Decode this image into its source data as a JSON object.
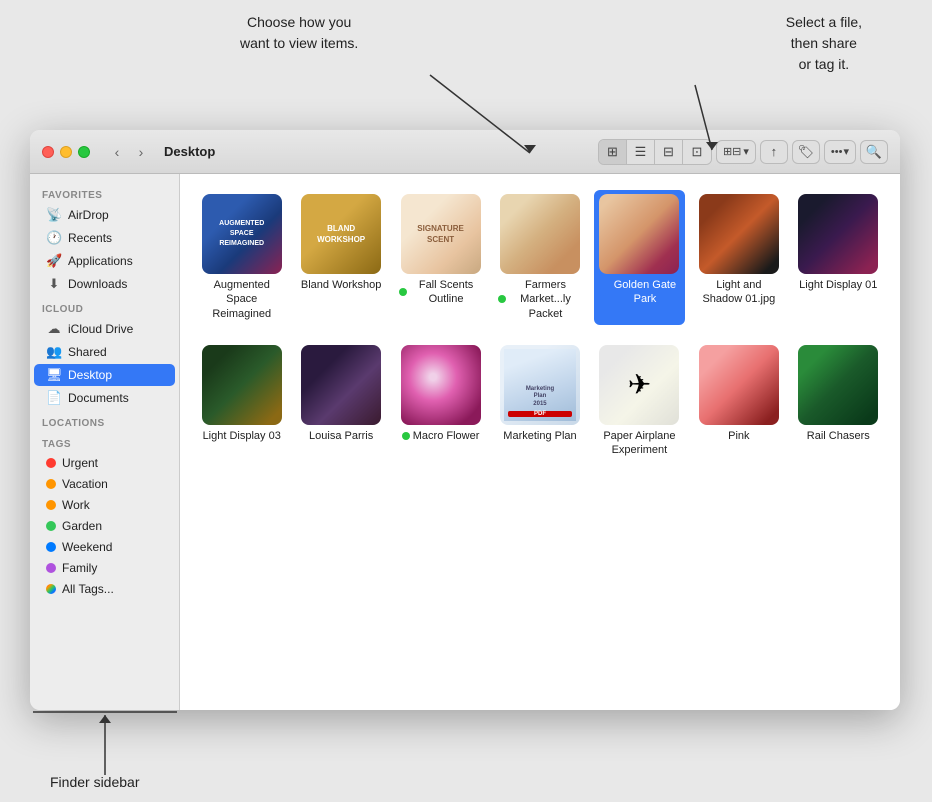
{
  "callouts": {
    "left": "Choose how you\nwant to view items.",
    "right": "Select a file,\nthen share\nor tag it.",
    "bottom": "Finder sidebar"
  },
  "window": {
    "title": "Desktop",
    "nav": {
      "back_label": "‹",
      "forward_label": "›"
    }
  },
  "toolbar": {
    "view_icons": [
      "⊞",
      "☰",
      "⊟",
      "⊡"
    ],
    "group_label": "⊞⊟",
    "share_icon": "↑",
    "tag_icon": "◉",
    "more_label": "•••",
    "search_icon": "🔍"
  },
  "sidebar": {
    "sections": [
      {
        "label": "Favorites",
        "items": [
          {
            "id": "airdrop",
            "icon": "📡",
            "label": "AirDrop"
          },
          {
            "id": "recents",
            "icon": "🕐",
            "label": "Recents"
          },
          {
            "id": "applications",
            "icon": "🚀",
            "label": "Applications"
          },
          {
            "id": "downloads",
            "icon": "⬇",
            "label": "Downloads"
          }
        ]
      },
      {
        "label": "iCloud",
        "items": [
          {
            "id": "icloud-drive",
            "icon": "☁",
            "label": "iCloud Drive"
          },
          {
            "id": "shared",
            "icon": "👥",
            "label": "Shared"
          },
          {
            "id": "desktop",
            "icon": "🖥",
            "label": "Desktop",
            "active": true
          },
          {
            "id": "documents",
            "icon": "📄",
            "label": "Documents"
          }
        ]
      },
      {
        "label": "Locations",
        "items": []
      },
      {
        "label": "Tags",
        "items": [
          {
            "id": "tag-urgent",
            "color": "#ff3b30",
            "label": "Urgent"
          },
          {
            "id": "tag-vacation",
            "color": "#ff9500",
            "label": "Vacation"
          },
          {
            "id": "tag-work",
            "color": "#ff9500",
            "label": "Work"
          },
          {
            "id": "tag-garden",
            "color": "#34c759",
            "label": "Garden"
          },
          {
            "id": "tag-weekend",
            "color": "#007aff",
            "label": "Weekend"
          },
          {
            "id": "tag-family",
            "color": "#af52de",
            "label": "Family"
          },
          {
            "id": "tag-all",
            "color": "#aaa",
            "label": "All Tags..."
          }
        ]
      }
    ]
  },
  "files": [
    {
      "id": "augmented",
      "name": "Augmented\nSpace Reimagined",
      "thumb_class": "thumb-augmented",
      "thumb_text": "AUGMENTED\nSPACE\nREIMAGINED",
      "dot": null,
      "selected": false
    },
    {
      "id": "bland-workshop",
      "name": "Bland Workshop",
      "thumb_class": "thumb-bland",
      "thumb_text": "BLAND\nWORKSHOP",
      "dot": null,
      "selected": false
    },
    {
      "id": "fall-scents",
      "name": "Fall Scents\nOutline",
      "thumb_class": "thumb-fall",
      "thumb_text": "SIGNATURE\nSCENT",
      "dot": "green",
      "selected": false
    },
    {
      "id": "farmers",
      "name": "Farmers\nMarket...ly Packet",
      "thumb_class": "thumb-farmers",
      "thumb_text": "",
      "dot": "green",
      "selected": false
    },
    {
      "id": "golden-gate",
      "name": "Golden Gate\nPark",
      "thumb_class": "thumb-golden",
      "thumb_text": "",
      "dot": "blue",
      "selected": true
    },
    {
      "id": "light-shadow",
      "name": "Light and Shadow\n01.jpg",
      "thumb_class": "thumb-light-shadow",
      "thumb_text": "",
      "dot": null,
      "selected": false
    },
    {
      "id": "light-display01",
      "name": "Light Display 01",
      "thumb_class": "thumb-light-display01",
      "thumb_text": "",
      "dot": null,
      "selected": false
    },
    {
      "id": "light03",
      "name": "Light Display 03",
      "thumb_class": "thumb-light03",
      "thumb_text": "",
      "dot": null,
      "selected": false
    },
    {
      "id": "louisa",
      "name": "Louisa Parris",
      "thumb_class": "thumb-louisa",
      "thumb_text": "",
      "dot": null,
      "selected": false
    },
    {
      "id": "macro",
      "name": "Macro Flower",
      "thumb_class": "thumb-macro",
      "thumb_text": "",
      "dot": "green",
      "selected": false
    },
    {
      "id": "marketing",
      "name": "Marketing Plan",
      "thumb_class": "thumb-marketing",
      "thumb_text": "Marketing\nPlan\n2015\nPDF",
      "dot": null,
      "selected": false
    },
    {
      "id": "paper",
      "name": "Paper Airplane\nExperiment",
      "thumb_class": "thumb-paper",
      "thumb_text": "",
      "dot": null,
      "selected": false
    },
    {
      "id": "pink",
      "name": "Pink",
      "thumb_class": "thumb-pink",
      "thumb_text": "",
      "dot": null,
      "selected": false
    },
    {
      "id": "rail-chasers",
      "name": "Rail Chasers",
      "thumb_class": "thumb-rail",
      "thumb_text": "",
      "dot": null,
      "selected": false
    }
  ]
}
